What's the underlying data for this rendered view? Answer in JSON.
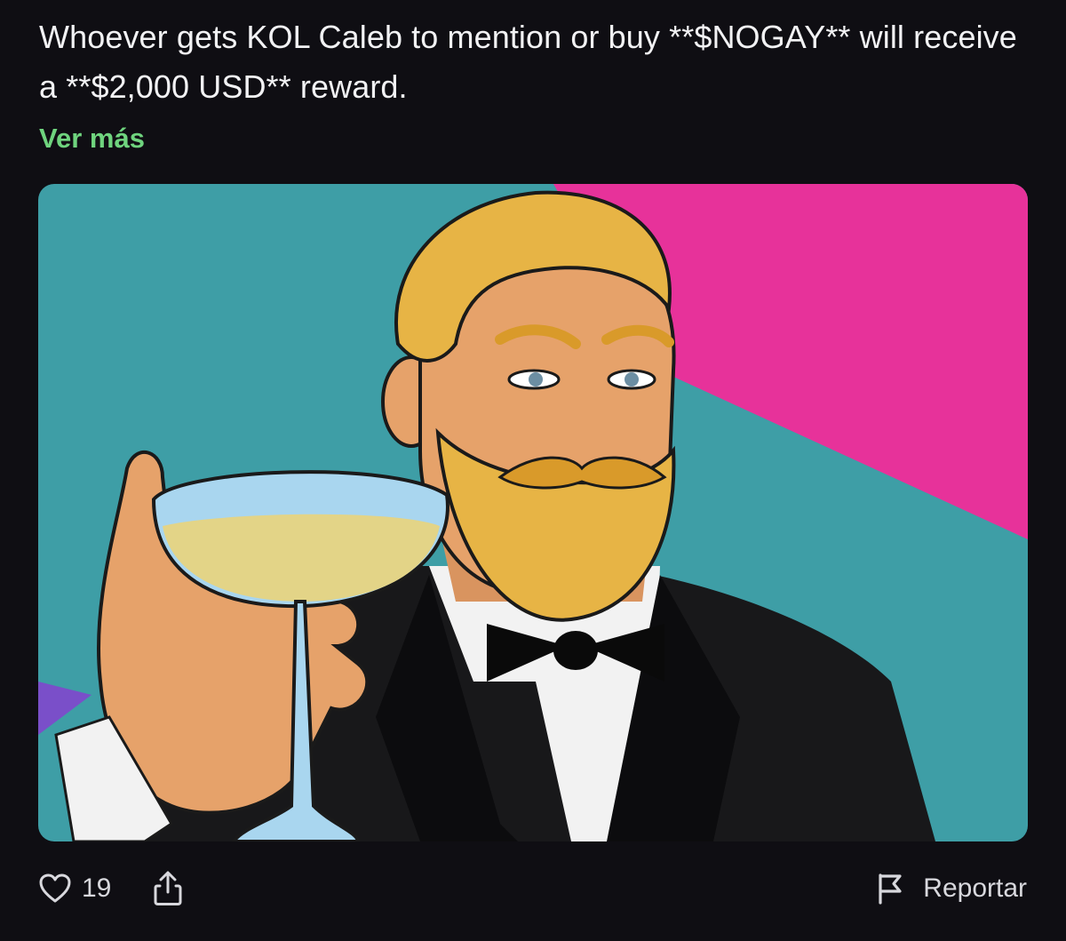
{
  "post": {
    "text": "Whoever gets KOL Caleb to mention or buy **$NOGAY** will receive a **$2,000 USD** reward.",
    "see_more_label": "Ver más",
    "see_more_color": "#6fd47e"
  },
  "media": {
    "alt": "Cartoon bearded man in a tuxedo raising a champagne glass",
    "colors": {
      "teal": "#3e9ea6",
      "pink": "#e7329a",
      "suit": "#18181a",
      "hair": "#e7b445",
      "skin": "#e6a26a",
      "glass": "#a9d6ef",
      "champagne": "#e3d487"
    }
  },
  "actions": {
    "like_icon": "heart-outline-icon",
    "like_count": "19",
    "share_icon": "share-icon",
    "report_icon": "flag-icon",
    "report_label": "Reportar"
  }
}
